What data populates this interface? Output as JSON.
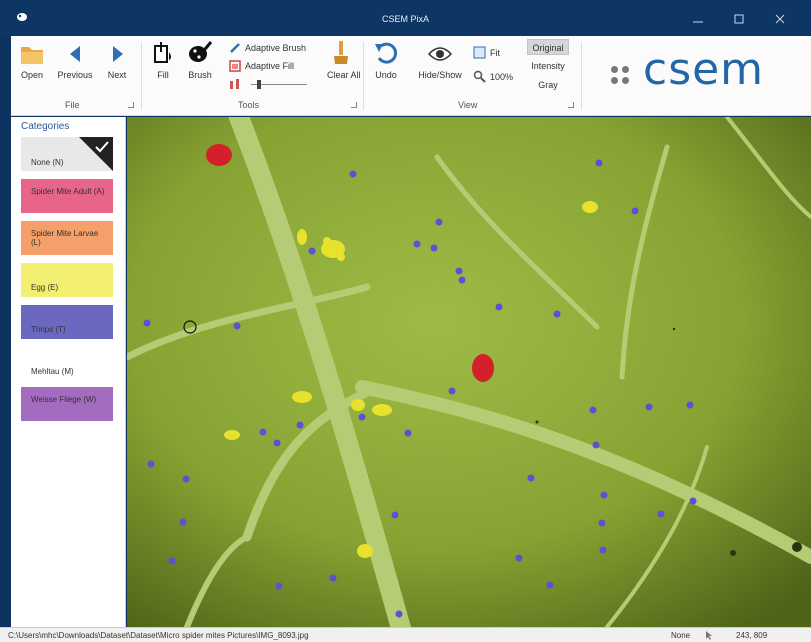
{
  "window": {
    "title": "CSEM PixA"
  },
  "ribbon": {
    "file": {
      "group_label": "File",
      "open": "Open",
      "previous": "Previous",
      "next": "Next"
    },
    "tools": {
      "group_label": "Tools",
      "fill": "Fill",
      "brush": "Brush",
      "adaptive_brush": "Adaptive Brush",
      "adaptive_fill": "Adaptive Fill",
      "clear_all": "Clear All"
    },
    "view": {
      "group_label": "View",
      "undo": "Undo",
      "hide_show": "Hide/Show",
      "fit": "Fit",
      "zoom": "100%",
      "options": [
        "Original",
        "Intensity",
        "Gray"
      ],
      "selected": "Original"
    },
    "logo": "csem"
  },
  "sidebar": {
    "heading": "Categories",
    "categories": [
      {
        "label": "None (N)",
        "color": "#e8e8e8",
        "selected": true
      },
      {
        "label": "Spider Mite Adult (A)",
        "color": "#e8658a"
      },
      {
        "label": "Spider Mite Larvae (L)",
        "color": "#f4a06a"
      },
      {
        "label": "Egg (E)",
        "color": "#f3ef70"
      },
      {
        "label": "Thrips (T)",
        "color": "#6a68bf"
      },
      {
        "label": "Mehltau (M)",
        "color": "#ffffff"
      },
      {
        "label": "Weisse Fliege (W)",
        "color": "#a36cbf"
      }
    ]
  },
  "status": {
    "path": "C:\\Users\\mhc\\Downloads\\Dataset\\Dataset\\Micro spider mites Pictures\\IMG_8093.jpg",
    "mode": "None",
    "coords": "243, 809"
  }
}
